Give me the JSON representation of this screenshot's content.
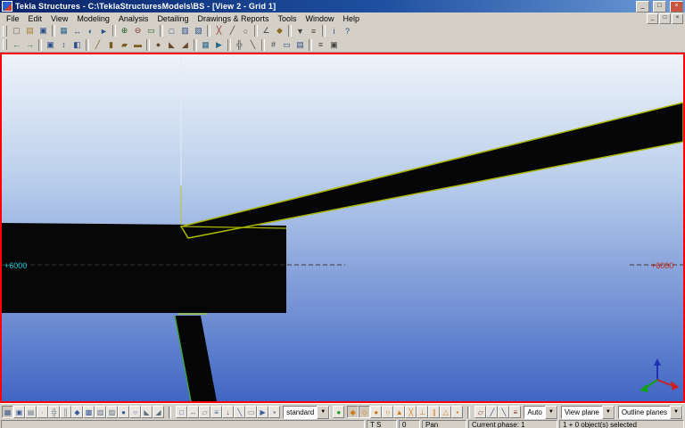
{
  "window": {
    "title": "Tekla Structures - C:\\TeklaStructuresModels\\BS - [View 2 - Grid 1]",
    "buttons": {
      "minimize": "_",
      "maximize": "□",
      "close": "×"
    }
  },
  "menubar": {
    "items": [
      "File",
      "Edit",
      "View",
      "Modeling",
      "Analysis",
      "Detailing",
      "Drawings & Reports",
      "Tools",
      "Window",
      "Help"
    ],
    "mdi_buttons": {
      "minimize": "_",
      "restore": "□",
      "close": "×"
    }
  },
  "toolbar1": {
    "icons": [
      {
        "n": "new-model",
        "g": "▢",
        "c": "#666666"
      },
      {
        "n": "open-model",
        "g": "▤",
        "c": "#a87b2d"
      },
      {
        "n": "save-model",
        "g": "▣",
        "c": "#2d4f8a"
      },
      {
        "sep": true
      },
      {
        "n": "fit-work-area",
        "g": "▦",
        "c": "#2d6a8a"
      },
      {
        "n": "pan-tool",
        "g": "↔",
        "c": "#2d4f8a"
      },
      {
        "n": "rotate-tool",
        "g": "◐",
        "c": "#2d4f8a"
      },
      {
        "n": "fly-tool",
        "g": "►",
        "c": "#2d4f8a"
      },
      {
        "sep": true
      },
      {
        "n": "zoom-in",
        "g": "⊕",
        "c": "#1f5f1f"
      },
      {
        "n": "zoom-out",
        "g": "⊖",
        "c": "#8a2d2d"
      },
      {
        "n": "zoom-window",
        "g": "▭",
        "c": "#1f5f1f"
      },
      {
        "sep": true
      },
      {
        "n": "create-view",
        "g": "□",
        "c": "#2d4f8a"
      },
      {
        "n": "view-list",
        "g": "▥",
        "c": "#2d4f8a"
      },
      {
        "n": "named-views",
        "g": "▧",
        "c": "#2d4f8a"
      },
      {
        "sep": true
      },
      {
        "n": "point-tool",
        "g": "╳",
        "c": "#8a2d2d"
      },
      {
        "n": "line-tool",
        "g": "╱",
        "c": "#444444"
      },
      {
        "n": "circle-tool",
        "g": "○",
        "c": "#444444"
      },
      {
        "sep": true
      },
      {
        "n": "measure-tool",
        "g": "∠",
        "c": "#444444"
      },
      {
        "n": "clash-check",
        "g": "◆",
        "c": "#8a6a1f"
      },
      {
        "sep": true
      },
      {
        "n": "select-filter",
        "g": "▼",
        "c": "#444444"
      },
      {
        "n": "phase-manager",
        "g": "≡",
        "c": "#444444"
      },
      {
        "sep": true
      },
      {
        "n": "inquire-object",
        "g": "i",
        "c": "#2d4f8a"
      },
      {
        "n": "help",
        "g": "?",
        "c": "#2d4f8a"
      }
    ]
  },
  "toolbar2": {
    "icons": [
      {
        "n": "undo",
        "g": "←",
        "c": "#2d6a2d"
      },
      {
        "n": "redo",
        "g": "→",
        "c": "#2d6a2d"
      },
      {
        "sep": true
      },
      {
        "n": "copy",
        "g": "▣",
        "c": "#2d4f8a"
      },
      {
        "n": "move",
        "g": "↕",
        "c": "#2d4f8a"
      },
      {
        "n": "mirror",
        "g": "◧",
        "c": "#2d4f8a"
      },
      {
        "sep": true
      },
      {
        "n": "create-beam",
        "g": "╱",
        "c": "#7a5a1f"
      },
      {
        "n": "create-column",
        "g": "▮",
        "c": "#7a5a1f"
      },
      {
        "n": "create-plate",
        "g": "▰",
        "c": "#7a5a1f"
      },
      {
        "n": "create-slab",
        "g": "▬",
        "c": "#7a5a1f"
      },
      {
        "sep": true
      },
      {
        "n": "bolts",
        "g": "●",
        "c": "#6a4a2d"
      },
      {
        "n": "welds",
        "g": "◣",
        "c": "#6a4a2d"
      },
      {
        "n": "cuts",
        "g": "◢",
        "c": "#6a4a2d"
      },
      {
        "sep": true
      },
      {
        "n": "components-catalog",
        "g": "▦",
        "c": "#2d6a8a"
      },
      {
        "n": "macros",
        "g": "▶",
        "c": "#2d6a8a"
      },
      {
        "sep": true
      },
      {
        "n": "grid-tool",
        "g": "╬",
        "c": "#444444"
      },
      {
        "n": "construction-line",
        "g": "╲",
        "c": "#444444"
      },
      {
        "sep": true
      },
      {
        "n": "numbering",
        "g": "#",
        "c": "#444444"
      },
      {
        "n": "drawings",
        "g": "▭",
        "c": "#2d4f8a"
      },
      {
        "n": "reports",
        "g": "▤",
        "c": "#2d4f8a"
      },
      {
        "sep": true
      },
      {
        "n": "properties",
        "g": "≡",
        "c": "#444444"
      },
      {
        "n": "options",
        "g": "▣",
        "c": "#444444"
      }
    ]
  },
  "viewport": {
    "labels": {
      "left_elevation": "+6000",
      "right_elevation": "+6000"
    },
    "colors": {
      "view_border": "#ff0000",
      "selection_outline": "#aab800",
      "background_top": "#eef3fa",
      "background_bottom": "#4166c4",
      "grid_label_left": "#22ccdd",
      "grid_label_right": "#cc2211"
    }
  },
  "bottombar": {
    "selection_switches": [
      {
        "n": "select-all",
        "g": "▦",
        "c": "#3a5a9a",
        "pressed": true
      },
      {
        "n": "select-parts",
        "g": "▣",
        "c": "#3a5a9a"
      },
      {
        "n": "select-surfaces",
        "g": "▤",
        "c": "#607080"
      },
      {
        "n": "select-points",
        "g": "∙",
        "c": "#3a5a9a"
      },
      {
        "n": "select-grids",
        "g": "╬",
        "c": "#607080"
      },
      {
        "n": "select-grid-lines",
        "g": "║",
        "c": "#607080"
      },
      {
        "n": "select-joints",
        "g": "◆",
        "c": "#3a5a9a"
      },
      {
        "n": "select-assemblies",
        "g": "▩",
        "c": "#3a5a9a"
      },
      {
        "n": "select-objects-in-assemblies",
        "g": "▧",
        "c": "#607080"
      },
      {
        "n": "select-objects-in-components",
        "g": "▨",
        "c": "#607080"
      },
      {
        "n": "select-bolts",
        "g": "●",
        "c": "#3a5a9a"
      },
      {
        "n": "select-single-bolts",
        "g": "○",
        "c": "#3a5a9a"
      },
      {
        "n": "select-welds",
        "g": "◣",
        "c": "#607080"
      },
      {
        "n": "select-cuts",
        "g": "◢",
        "c": "#607080"
      }
    ],
    "selection_switches2": [
      {
        "n": "select-views",
        "g": "□",
        "c": "#3a5a9a"
      },
      {
        "n": "select-distances",
        "g": "↔",
        "c": "#607080"
      },
      {
        "n": "select-planes",
        "g": "▱",
        "c": "#607080"
      },
      {
        "n": "select-phases",
        "g": "≡",
        "c": "#3a5a9a"
      },
      {
        "n": "select-loads",
        "g": "↓",
        "c": "#8a2d2d"
      },
      {
        "n": "select-reinforcement",
        "g": "╲",
        "c": "#3a5a9a"
      },
      {
        "n": "select-surfaces-only",
        "g": "▭",
        "c": "#607080"
      },
      {
        "n": "select-components",
        "g": "▶",
        "c": "#3a5a9a"
      },
      {
        "n": "select-objects",
        "g": "▪",
        "c": "#607080"
      }
    ],
    "selection_filter": {
      "value": "standard"
    },
    "apply_filter": {
      "n": "apply-filter",
      "g": "●",
      "c": "#18a018"
    },
    "snap_switches": [
      {
        "n": "snap-reference-points",
        "g": "◆",
        "c": "#d07818",
        "pressed": true
      },
      {
        "n": "snap-geometry-points",
        "g": "◇",
        "c": "#d07818",
        "pressed": true
      },
      {
        "n": "snap-end-points",
        "g": "●",
        "c": "#d07818"
      },
      {
        "n": "snap-center-points",
        "g": "○",
        "c": "#d07818"
      },
      {
        "n": "snap-midpoints",
        "g": "▲",
        "c": "#d07818"
      },
      {
        "n": "snap-intersections",
        "g": "╳",
        "c": "#d07818"
      },
      {
        "n": "snap-perpendicular",
        "g": "⊥",
        "c": "#d07818"
      },
      {
        "n": "snap-line-extensions",
        "g": "∥",
        "c": "#d07818"
      },
      {
        "n": "snap-nearest",
        "g": "△",
        "c": "#d07818"
      },
      {
        "n": "snap-any",
        "g": "▪",
        "c": "#d07818"
      }
    ],
    "snap_overrides": [
      {
        "n": "snap-override-plane",
        "g": "▱",
        "c": "#8a2d2d"
      },
      {
        "n": "snap-override-x",
        "g": "╱",
        "c": "#2d4f8a"
      },
      {
        "n": "snap-override-y",
        "g": "╲",
        "c": "#2d4f8a"
      },
      {
        "n": "snap-lock-coordinate",
        "g": "≡",
        "c": "#8a2d2d"
      }
    ],
    "combos": {
      "snap_depth": "Auto",
      "view_plane": "View plane",
      "outline_planes": "Outline planes"
    }
  },
  "statusbar": {
    "segments": [
      "",
      "T S",
      "0",
      "Pan",
      "Current phase: 1",
      "1 + 0 object(s) selected"
    ]
  }
}
